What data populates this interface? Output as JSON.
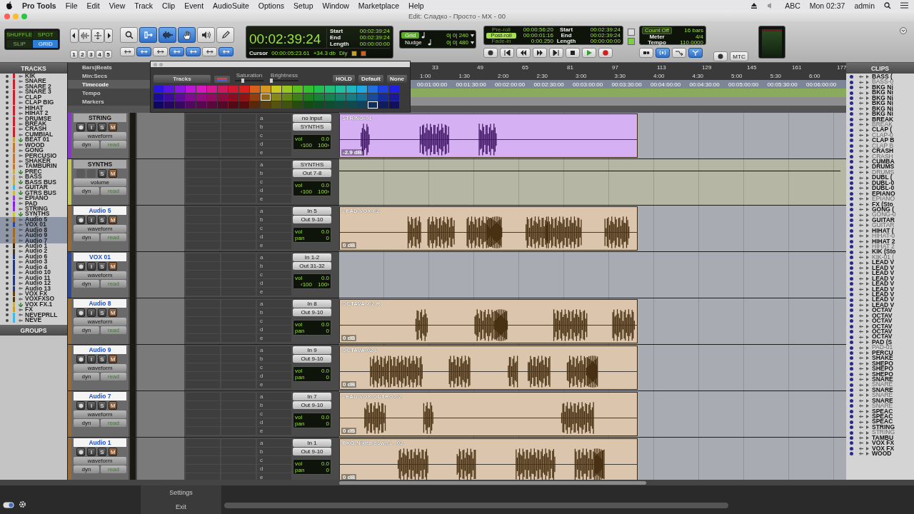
{
  "menu_bar": {
    "app": "Pro Tools",
    "menus": [
      "File",
      "Edit",
      "View",
      "Track",
      "Clip",
      "Event",
      "AudioSuite",
      "Options",
      "Setup",
      "Window",
      "Marketplace",
      "Help"
    ],
    "status": [
      "ABC",
      "Mon 02:37",
      "admin"
    ]
  },
  "window": {
    "title": "Edit: Сладко - Просто - MX - 00"
  },
  "toolbar": {
    "edit_modes": [
      {
        "label": "SHUFFLE",
        "selected": false
      },
      {
        "label": "SPOT",
        "selected": false
      },
      {
        "label": "SLIP",
        "selected": false
      },
      {
        "label": "GRID",
        "selected": true
      }
    ],
    "zoom_presets": [
      "1",
      "2",
      "3",
      "4",
      "5"
    ],
    "tools": [
      {
        "kind": "zoom",
        "selected": false
      },
      {
        "kind": "trim",
        "selected": true
      },
      {
        "kind": "select",
        "selected": true
      },
      {
        "kind": "grab",
        "selected": true
      },
      {
        "kind": "scrub",
        "selected": false
      },
      {
        "kind": "pencil",
        "selected": false
      }
    ],
    "edit_options": [
      {
        "selected": false
      },
      {
        "selected": true
      },
      {
        "selected": false
      },
      {
        "selected": true
      },
      {
        "selected": true
      },
      {
        "selected": false
      },
      {
        "selected": true
      }
    ],
    "main_counter": {
      "time": "00:02:39:24",
      "rows": [
        {
          "label": "Start",
          "value": "00:02:39:24"
        },
        {
          "label": "End",
          "value": "00:02:39:24"
        },
        {
          "label": "Length",
          "value": "00:00:00:00"
        }
      ],
      "cursor_label": "Cursor",
      "cursor": "00:00:05:23.61",
      "reading": "+34.3 db",
      "delay": "Dly"
    },
    "grid": {
      "label": "Grid",
      "value": "0| 0| 240"
    },
    "nudge": {
      "label": "Nudge",
      "value": "0| 0| 480"
    },
    "rolls": [
      {
        "label": "Pre-roll",
        "value": "00:00:56:20",
        "on": false
      },
      {
        "label": "Post-roll",
        "value": "00:00:01:16",
        "on": true
      },
      {
        "label": "Fade-in",
        "value": "0:00.250",
        "on": false
      }
    ],
    "selection": [
      {
        "label": "Start",
        "value": "00:02:39:24"
      },
      {
        "label": "End",
        "value": "00:02:39:24"
      },
      {
        "label": "Length",
        "value": "00:00:00:00"
      }
    ],
    "count_off": {
      "label": "Count Off",
      "value": "16 bars"
    },
    "meter": {
      "label": "Meter",
      "value": "4/4"
    },
    "tempo": {
      "label": "Tempo",
      "value": "110.0000"
    },
    "sync_button": "MTC"
  },
  "color_palette": {
    "target": "Tracks",
    "saturation": {
      "label": "Saturation",
      "level": 0.28
    },
    "brightness": {
      "label": "Brightness",
      "level": 0.06
    },
    "buttons": [
      "HOLD",
      "Default",
      "None"
    ],
    "swatches": [
      {
        "color": "#2a14e0",
        "selected": false
      },
      {
        "color": "#5a14e0",
        "selected": false
      },
      {
        "color": "#8a14e0",
        "selected": false
      },
      {
        "color": "#c014d8",
        "selected": false
      },
      {
        "color": "#d818c0",
        "selected": false
      },
      {
        "color": "#d81890",
        "selected": false
      },
      {
        "color": "#d01860",
        "selected": false
      },
      {
        "color": "#d01830",
        "selected": false
      },
      {
        "color": "#d82020",
        "selected": false
      },
      {
        "color": "#d86018",
        "selected": false
      },
      {
        "color": "#d89820",
        "selected": false
      },
      {
        "color": "#c8c820",
        "selected": false
      },
      {
        "color": "#98c820",
        "selected": false
      },
      {
        "color": "#60c020",
        "selected": false
      },
      {
        "color": "#30c030",
        "selected": false
      },
      {
        "color": "#20c050",
        "selected": false
      },
      {
        "color": "#20c078",
        "selected": false
      },
      {
        "color": "#20c0a0",
        "selected": false
      },
      {
        "color": "#20b8c0",
        "selected": false
      },
      {
        "color": "#20a8e0",
        "selected": false
      },
      {
        "color": "#2070e0",
        "selected": false
      },
      {
        "color": "#2040e0",
        "selected": false
      },
      {
        "color": "#2020e0",
        "selected": false
      },
      {
        "color": "#1c0c98",
        "selected": false
      },
      {
        "color": "#3c0c98",
        "selected": false
      },
      {
        "color": "#5c0c98",
        "selected": false
      },
      {
        "color": "#820c90",
        "selected": false
      },
      {
        "color": "#920c80",
        "selected": false
      },
      {
        "color": "#920c60",
        "selected": false
      },
      {
        "color": "#8c0c40",
        "selected": false
      },
      {
        "color": "#8c0c20",
        "selected": false
      },
      {
        "color": "#901414",
        "selected": false
      },
      {
        "color": "#904010",
        "selected": false
      },
      {
        "color": "#906818",
        "selected": true
      },
      {
        "color": "#888818",
        "selected": false
      },
      {
        "color": "#668818",
        "selected": false
      },
      {
        "color": "#408018",
        "selected": false
      },
      {
        "color": "#208020",
        "selected": false
      },
      {
        "color": "#188038",
        "selected": false
      },
      {
        "color": "#188050",
        "selected": false
      },
      {
        "color": "#18806c",
        "selected": false
      },
      {
        "color": "#187c80",
        "selected": false
      },
      {
        "color": "#187098",
        "selected": false
      },
      {
        "color": "#184c98",
        "selected": false
      },
      {
        "color": "#182c98",
        "selected": false
      },
      {
        "color": "#181898",
        "selected": false
      },
      {
        "color": "#100860",
        "selected": false
      },
      {
        "color": "#240860",
        "selected": false
      },
      {
        "color": "#380860",
        "selected": false
      },
      {
        "color": "#500860",
        "selected": false
      },
      {
        "color": "#580850",
        "selected": false
      },
      {
        "color": "#58083c",
        "selected": false
      },
      {
        "color": "#560828",
        "selected": false
      },
      {
        "color": "#560814",
        "selected": false
      },
      {
        "color": "#580c0c",
        "selected": false
      },
      {
        "color": "#582808",
        "selected": false
      },
      {
        "color": "#584010",
        "selected": false
      },
      {
        "color": "#545410",
        "selected": false
      },
      {
        "color": "#405410",
        "selected": false
      },
      {
        "color": "#284c10",
        "selected": false
      },
      {
        "color": "#144c14",
        "selected": false
      },
      {
        "color": "#104c24",
        "selected": false
      },
      {
        "color": "#104c30",
        "selected": false
      },
      {
        "color": "#104c40",
        "selected": false
      },
      {
        "color": "#104a4c",
        "selected": false
      },
      {
        "color": "#10445c",
        "selected": false
      },
      {
        "color": "#102e5c",
        "selected": true
      },
      {
        "color": "#101c5c",
        "selected": false
      },
      {
        "color": "#10105c",
        "selected": false
      }
    ]
  },
  "tracks_list": {
    "title": "TRACKS",
    "items": [
      {
        "name": "KIK",
        "color": "#c8202c",
        "kind": "audio",
        "selected": false
      },
      {
        "name": "SNARE",
        "color": "#c8202c",
        "kind": "audio",
        "selected": false
      },
      {
        "name": "SNARE 2",
        "color": "#c8202c",
        "kind": "audio",
        "selected": false
      },
      {
        "name": "SNARE 3",
        "color": "#c8202c",
        "kind": "audio",
        "selected": false
      },
      {
        "name": "CLAP",
        "color": "#c8202c",
        "kind": "audio",
        "selected": false
      },
      {
        "name": "CLAP BIG",
        "color": "#c8202c",
        "kind": "audio",
        "selected": false
      },
      {
        "name": "HIHAT",
        "color": "#c8202c",
        "kind": "audio",
        "selected": false
      },
      {
        "name": "HIHAT 2",
        "color": "#c8202c",
        "kind": "audio",
        "selected": false
      },
      {
        "name": "DRUMSE",
        "color": "#c8202c",
        "kind": "audio",
        "selected": false
      },
      {
        "name": "BREAK",
        "color": "#c8202c",
        "kind": "audio",
        "selected": false
      },
      {
        "name": "CRASH",
        "color": "#c8202c",
        "kind": "audio",
        "selected": false
      },
      {
        "name": "CUMBIAL",
        "color": "#c8202c",
        "kind": "audio",
        "selected": false
      },
      {
        "name": "BEAT 01",
        "color": "#c8a048",
        "kind": "aux",
        "selected": false
      },
      {
        "name": "WOOD",
        "color": "#c07838",
        "kind": "audio",
        "selected": false
      },
      {
        "name": "GONG",
        "color": "#c07838",
        "kind": "audio",
        "selected": false
      },
      {
        "name": "PERCUSIO",
        "color": "#c07838",
        "kind": "audio",
        "selected": false
      },
      {
        "name": "SHAKER",
        "color": "#c07838",
        "kind": "audio",
        "selected": false
      },
      {
        "name": "TAMBURIN",
        "color": "#c07838",
        "kind": "audio",
        "selected": false
      },
      {
        "name": "PREC",
        "color": "#c8b050",
        "kind": "aux",
        "selected": false
      },
      {
        "name": "BASS",
        "color": "#c8a060",
        "kind": "audio",
        "selected": false
      },
      {
        "name": "BASS BUS",
        "color": "#c8b050",
        "kind": "aux",
        "selected": false
      },
      {
        "name": "GUITAR",
        "color": "#40b8e8",
        "kind": "audio",
        "selected": false
      },
      {
        "name": "GTRS BUS",
        "color": "#c8c040",
        "kind": "aux",
        "selected": false
      },
      {
        "name": "EPIANO",
        "color": "#9040d0",
        "kind": "audio",
        "selected": false
      },
      {
        "name": "PAD",
        "color": "#8020e0",
        "kind": "audio",
        "selected": false
      },
      {
        "name": "STRING",
        "color": "#9030e0",
        "kind": "audio",
        "selected": false
      },
      {
        "name": "SYNTHS",
        "color": "#c8c840",
        "kind": "aux",
        "selected": false
      },
      {
        "name": "Audio 5",
        "color": "#a06a28",
        "kind": "audio",
        "selected": true
      },
      {
        "name": "VOX 01",
        "color": "#2848a8",
        "kind": "audio",
        "selected": true
      },
      {
        "name": "Audio 8",
        "color": "#a06a28",
        "kind": "audio",
        "selected": true
      },
      {
        "name": "Audio 9",
        "color": "#a06a28",
        "kind": "audio",
        "selected": true
      },
      {
        "name": "Audio 7",
        "color": "#a06a28",
        "kind": "audio",
        "selected": true
      },
      {
        "name": "Audio 1",
        "color": "#3a2c14",
        "kind": "audio",
        "selected": false
      },
      {
        "name": "Audio 2",
        "color": "#4a3418",
        "kind": "audio",
        "selected": false
      },
      {
        "name": "Audio 6",
        "color": "#283870",
        "kind": "audio",
        "selected": false
      },
      {
        "name": "Audio 3",
        "color": "#283870",
        "kind": "audio",
        "selected": false
      },
      {
        "name": "Audio 4",
        "color": "#283870",
        "kind": "audio",
        "selected": false
      },
      {
        "name": "Audio 10",
        "color": "#283870",
        "kind": "audio",
        "selected": false
      },
      {
        "name": "Audio 11",
        "color": "#283870",
        "kind": "audio",
        "selected": false
      },
      {
        "name": "Audio 12",
        "color": "#283870",
        "kind": "audio",
        "selected": false
      },
      {
        "name": "Audio 13",
        "color": "#283870",
        "kind": "audio",
        "selected": false
      },
      {
        "name": "VOX FX",
        "color": "#5a4418",
        "kind": "audio",
        "selected": false
      },
      {
        "name": "VOXFXSO",
        "color": "#4a3a18",
        "kind": "audio",
        "selected": false
      },
      {
        "name": "VOX FX.1",
        "color": "#c8b050",
        "kind": "aux",
        "selected": false
      },
      {
        "name": "FX",
        "color": "#c8a030",
        "kind": "audio",
        "selected": false
      },
      {
        "name": "NEVEPRLL",
        "color": "#40b8e8",
        "kind": "audio",
        "selected": false
      },
      {
        "name": "NEVE",
        "color": "#40b8e8",
        "kind": "audio",
        "selected": false
      }
    ]
  },
  "groups": {
    "title": "GROUPS"
  },
  "rulers": [
    {
      "label": "Bars|Beats",
      "selected": false,
      "ticks": [
        "33",
        "49",
        "65",
        "81",
        "97",
        "113",
        "129",
        "145",
        "161",
        "177"
      ]
    },
    {
      "label": "Min:Secs",
      "selected": false,
      "ticks": [
        "1:00",
        "1:30",
        "2:00",
        "2:30",
        "3:00",
        "3:30",
        "4:00",
        "4:30",
        "5:00",
        "5:30",
        "6:00"
      ]
    },
    {
      "label": "Timecode",
      "selected": true,
      "ticks": [
        "00:01:00:00",
        "00:01:30:00",
        "00:02:00:00",
        "00:02:30:00",
        "00:03:00:00",
        "00:03:30:00",
        "00:04:00:00",
        "00:04:30:00",
        "00:05:00:00",
        "00:05:30:00",
        "00:06:00:00"
      ]
    },
    {
      "label": "Tempo",
      "selected": false
    },
    {
      "label": "Markers",
      "selected": false
    }
  ],
  "tracks": [
    {
      "name": "STRING",
      "color": "#9030e0",
      "kind": "audio",
      "selected": false,
      "buttons": [
        {
          "kind": "input",
          "label": "I"
        },
        {
          "kind": "solo",
          "label": "S"
        },
        {
          "kind": "mute",
          "label": "M"
        }
      ],
      "view": "waveform",
      "dyn": "dyn",
      "automation": "read",
      "sends": [
        "a",
        "b",
        "c",
        "d",
        "e"
      ],
      "input": "no input",
      "output": "SYNTHS",
      "volume_label": "vol",
      "volume": "0.0",
      "pan": [
        "‹100",
        "100›"
      ],
      "clip": {
        "name": "STRING-01",
        "gain": "-2.9 dB"
      }
    },
    {
      "name": "SYNTHS",
      "color": "#c8c840",
      "kind": "aux",
      "selected": false,
      "buttons": [
        {
          "kind": "solo",
          "label": "S"
        },
        {
          "kind": "mute",
          "label": "M"
        }
      ],
      "view": "volume",
      "dyn": "dyn",
      "automation": "read",
      "sends": [
        "a",
        "b",
        "c",
        "d",
        "e"
      ],
      "input": "SYNTHS",
      "output": "Out 7-8",
      "volume_label": "vol",
      "volume": "0.0",
      "pan": [
        "‹100",
        "100›"
      ]
    },
    {
      "name": "Audio 5",
      "color": "#a06a28",
      "kind": "audio",
      "selected": true,
      "buttons": [
        {
          "kind": "input",
          "label": "I"
        },
        {
          "kind": "solo",
          "label": "S"
        },
        {
          "kind": "mute",
          "label": "M"
        }
      ],
      "view": "waveform",
      "dyn": "dyn",
      "automation": "read",
      "sends": [
        "a",
        "b",
        "c",
        "d",
        "e"
      ],
      "input": "In 5",
      "output": "Out 9-10",
      "volume_label": "vol",
      "volume": "0.0",
      "pan_label": "pan",
      "pan": [
        "0"
      ],
      "clip": {
        "name": "LEAD VOX-02",
        "gain": "0 dB"
      }
    },
    {
      "name": "VOX 01",
      "color": "#2848a8",
      "kind": "audio",
      "selected": true,
      "buttons": [
        {
          "kind": "input",
          "label": "I"
        },
        {
          "kind": "solo",
          "label": "S"
        },
        {
          "kind": "mute",
          "label": "M"
        }
      ],
      "view": "waveform",
      "dyn": "dyn",
      "automation": "read",
      "sends": [
        "a",
        "b",
        "c",
        "d",
        "e"
      ],
      "input": "In 1-2",
      "output": "Out 31-32",
      "volume_label": "vol",
      "volume": "0.0",
      "pan": [
        "‹100",
        "100›"
      ]
    },
    {
      "name": "Audio 8",
      "color": "#a06a28",
      "kind": "audio",
      "selected": true,
      "buttons": [
        {
          "kind": "input",
          "label": "I"
        },
        {
          "kind": "solo",
          "label": "S"
        },
        {
          "kind": "mute",
          "label": "M"
        }
      ],
      "view": "waveform",
      "dyn": "dyn",
      "automation": "read",
      "sends": [
        "a",
        "b",
        "c",
        "d",
        "e"
      ],
      "input": "In 8",
      "output": "Out 9-10",
      "volume_label": "vol",
      "volume": "0.0",
      "pan_label": "pan",
      "pan": [
        "0"
      ],
      "clip": {
        "name": "OCTAVA -02 R",
        "gain": "0 dB"
      }
    },
    {
      "name": "Audio 9",
      "color": "#a06a28",
      "kind": "audio",
      "selected": true,
      "buttons": [
        {
          "kind": "input",
          "label": "I"
        },
        {
          "kind": "solo",
          "label": "S"
        },
        {
          "kind": "mute",
          "label": "M"
        }
      ],
      "view": "waveform",
      "dyn": "dyn",
      "automation": "read",
      "sends": [
        "a",
        "b",
        "c",
        "d",
        "e"
      ],
      "input": "In 9",
      "output": "Out 9-10",
      "volume_label": "vol",
      "volume": "0.0",
      "pan_label": "pan",
      "pan": [
        "0"
      ],
      "clip": {
        "name": "OCTAVA-02 L",
        "gain": "0 dB"
      }
    },
    {
      "name": "Audio 7",
      "color": "#a06a28",
      "kind": "audio",
      "selected": true,
      "buttons": [
        {
          "kind": "input",
          "label": "I"
        },
        {
          "kind": "solo",
          "label": "S"
        },
        {
          "kind": "mute",
          "label": "M"
        }
      ],
      "view": "waveform",
      "dyn": "dyn",
      "automation": "read",
      "sends": [
        "a",
        "b",
        "c",
        "d",
        "e"
      ],
      "input": "In 7",
      "output": "Out 9-10",
      "volume_label": "vol",
      "volume": "0.0",
      "pan_label": "pan",
      "pan": [
        "0"
      ],
      "clip": {
        "name": "LEAD VOX OUTRO-02",
        "gain": "0 dB"
      }
    },
    {
      "name": "Audio 1",
      "color": "#a06a28",
      "kind": "audio",
      "selected": true,
      "buttons": [
        {
          "kind": "input",
          "label": "I"
        },
        {
          "kind": "solo",
          "label": "S"
        },
        {
          "kind": "mute",
          "label": "M"
        }
      ],
      "view": "waveform",
      "dyn": "dyn",
      "automation": "read",
      "sends": [
        "a",
        "b",
        "c",
        "d",
        "e"
      ],
      "input": "In 1",
      "output": "Out 9-10",
      "volume_label": "vol",
      "volume": "0.0",
      "pan_label": "pan",
      "pan": [
        "0"
      ],
      "clip": {
        "name": "BKG Nikita down  L -02",
        "gain": "0 dB"
      }
    }
  ],
  "clips_list": {
    "title": "CLIPS",
    "items": [
      {
        "name": "BASS (",
        "kind": "whole"
      },
      {
        "name": "BASS-0",
        "kind": "part"
      },
      {
        "name": "BKG Ni",
        "kind": "whole"
      },
      {
        "name": "BKG Ni",
        "kind": "whole"
      },
      {
        "name": "BKG Ni",
        "kind": "whole"
      },
      {
        "name": "BKG Ni",
        "kind": "whole"
      },
      {
        "name": "BKG Ni",
        "kind": "whole"
      },
      {
        "name": "BKG Ni",
        "kind": "whole"
      },
      {
        "name": "BREAK",
        "kind": "whole"
      },
      {
        "name": "BREAK",
        "kind": "part"
      },
      {
        "name": "CLAP (",
        "kind": "whole"
      },
      {
        "name": "CLAP-0",
        "kind": "part"
      },
      {
        "name": "CLAP B",
        "kind": "whole"
      },
      {
        "name": "CLAP B",
        "kind": "part"
      },
      {
        "name": "CRASH",
        "kind": "whole"
      },
      {
        "name": "CRASH",
        "kind": "part"
      },
      {
        "name": "CUMBA",
        "kind": "whole"
      },
      {
        "name": "DRUMS",
        "kind": "whole"
      },
      {
        "name": "DRUMS",
        "kind": "part"
      },
      {
        "name": "DUBL (",
        "kind": "whole"
      },
      {
        "name": "DUBL-0",
        "kind": "whole"
      },
      {
        "name": "DUBL-0",
        "kind": "whole"
      },
      {
        "name": "EPIANO",
        "kind": "whole"
      },
      {
        "name": "EPIANO",
        "kind": "part"
      },
      {
        "name": "FX (Sto",
        "kind": "whole"
      },
      {
        "name": "GONG (",
        "kind": "whole"
      },
      {
        "name": "GONG-0",
        "kind": "part"
      },
      {
        "name": "GUITAR",
        "kind": "whole"
      },
      {
        "name": "GUITAR",
        "kind": "part"
      },
      {
        "name": "HIHAT (",
        "kind": "whole"
      },
      {
        "name": "HIHAT-0",
        "kind": "part"
      },
      {
        "name": "HIHAT 2",
        "kind": "whole"
      },
      {
        "name": "HIHAT 2",
        "kind": "part"
      },
      {
        "name": "KIK (Sto",
        "kind": "whole"
      },
      {
        "name": "KIK-01 (",
        "kind": "part"
      },
      {
        "name": "LEAD V",
        "kind": "whole"
      },
      {
        "name": "LEAD V",
        "kind": "whole"
      },
      {
        "name": "LEAD V",
        "kind": "whole"
      },
      {
        "name": "LEAD V",
        "kind": "whole"
      },
      {
        "name": "LEAD V",
        "kind": "whole"
      },
      {
        "name": "LEAD V",
        "kind": "whole"
      },
      {
        "name": "LEAD V",
        "kind": "whole"
      },
      {
        "name": "LEAD V",
        "kind": "whole"
      },
      {
        "name": "LEAD V",
        "kind": "whole"
      },
      {
        "name": "OCTAV",
        "kind": "whole"
      },
      {
        "name": "OCTAV",
        "kind": "whole"
      },
      {
        "name": "OCTAV",
        "kind": "whole"
      },
      {
        "name": "OCTAV",
        "kind": "whole"
      },
      {
        "name": "OCTAV",
        "kind": "whole"
      },
      {
        "name": "OCTAV",
        "kind": "whole"
      },
      {
        "name": "PAD (S",
        "kind": "whole"
      },
      {
        "name": "PAD-01",
        "kind": "part"
      },
      {
        "name": "PERCU",
        "kind": "whole"
      },
      {
        "name": "SHAKE",
        "kind": "whole"
      },
      {
        "name": "SHEPO",
        "kind": "whole"
      },
      {
        "name": "SHEPO",
        "kind": "whole"
      },
      {
        "name": "SHEPO",
        "kind": "whole"
      },
      {
        "name": "SNARE",
        "kind": "whole"
      },
      {
        "name": "SNARE",
        "kind": "part"
      },
      {
        "name": "SNARE",
        "kind": "whole"
      },
      {
        "name": "SNARE",
        "kind": "part"
      },
      {
        "name": "SNARE",
        "kind": "whole"
      },
      {
        "name": "SNARE",
        "kind": "part"
      },
      {
        "name": "SPEAC",
        "kind": "whole"
      },
      {
        "name": "SPEAC",
        "kind": "whole"
      },
      {
        "name": "SPEAC",
        "kind": "whole"
      },
      {
        "name": "STRING",
        "kind": "whole"
      },
      {
        "name": "STRING",
        "kind": "part"
      },
      {
        "name": "TAMBU",
        "kind": "whole"
      },
      {
        "name": "VOX FX",
        "kind": "whole"
      },
      {
        "name": "VOX FX",
        "kind": "whole"
      },
      {
        "name": "WOOD",
        "kind": "whole"
      }
    ]
  },
  "bottom_menu": [
    "Settings",
    "Exit"
  ]
}
